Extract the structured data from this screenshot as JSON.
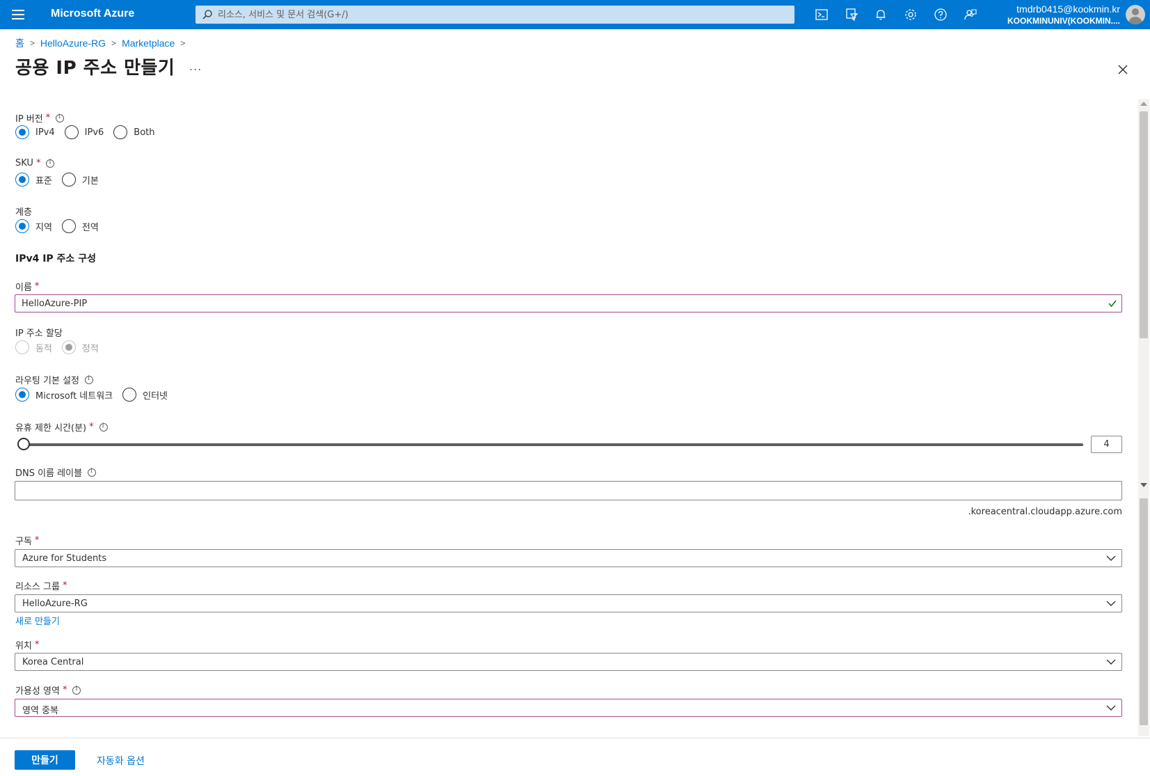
{
  "topbar": {
    "brand": "Microsoft Azure",
    "search_placeholder": "리소스, 서비스 및 문서 검색(G+/)",
    "user_email": "tmdrb0415@kookmin.kr",
    "user_tenant": "KOOKMINUNIV(KOOKMIN...."
  },
  "breadcrumb": {
    "items": [
      "홈",
      "HelloAzure-RG",
      "Marketplace"
    ]
  },
  "page": {
    "title": "공용 IP 주소 만들기",
    "more": "..."
  },
  "form": {
    "ip_version": {
      "label": "IP 버전",
      "options": [
        "IPv4",
        "IPv6",
        "Both"
      ],
      "selected": "IPv4"
    },
    "sku": {
      "label": "SKU",
      "options": [
        "표준",
        "기본"
      ],
      "selected": "표준"
    },
    "tier": {
      "label": "계층",
      "options": [
        "지역",
        "전역"
      ],
      "selected": "지역"
    },
    "section_title": "IPv4 IP 주소 구성",
    "name": {
      "label": "이름",
      "value": "HelloAzure-PIP"
    },
    "ip_assignment": {
      "label": "IP 주소 할당",
      "options": [
        "동적",
        "정적"
      ],
      "selected": "정적"
    },
    "routing": {
      "label": "라우팅 기본 설정",
      "options": [
        "Microsoft 네트워크",
        "인터넷"
      ],
      "selected": "Microsoft 네트워크"
    },
    "idle_timeout": {
      "label": "유휴 제한 시간(분)",
      "value": "4"
    },
    "dns_label": {
      "label": "DNS 이름 레이블",
      "value": "",
      "suffix": ".koreacentral.cloudapp.azure.com"
    },
    "subscription": {
      "label": "구독",
      "value": "Azure for Students"
    },
    "resource_group": {
      "label": "리소스 그룹",
      "value": "HelloAzure-RG",
      "create_new": "새로 만들기"
    },
    "location": {
      "label": "위치",
      "value": "Korea Central"
    },
    "availability_zone": {
      "label": "가용성 영역",
      "value": "영역 중복"
    }
  },
  "footer": {
    "create_label": "만들기",
    "automation_label": "자동화 옵션"
  },
  "colors": {
    "accent": "#0078d4",
    "required": "#a4262c",
    "focus_border": "#9b4f96",
    "valid": "#107c10"
  }
}
